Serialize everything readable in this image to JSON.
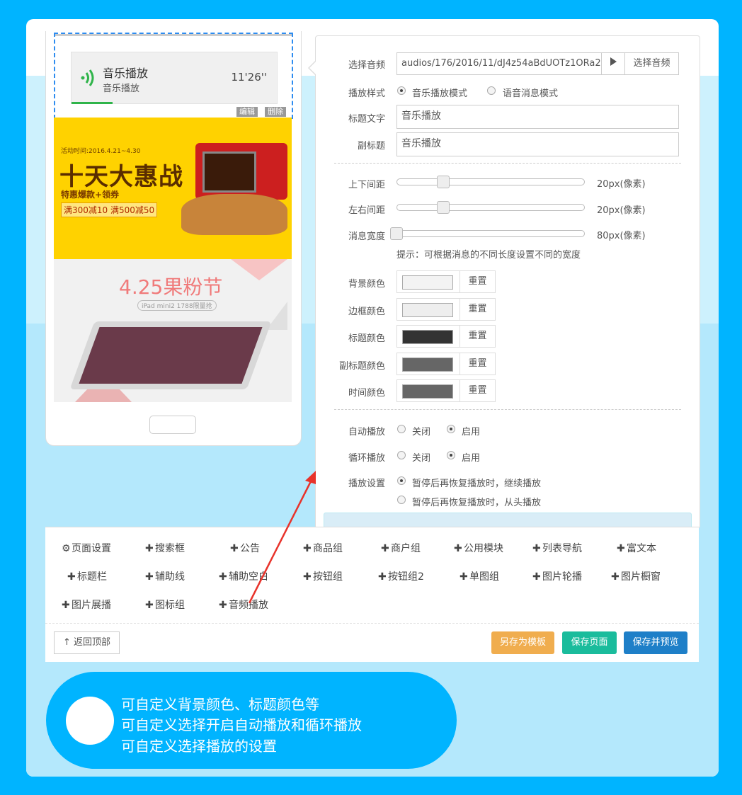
{
  "preview": {
    "audio": {
      "title": "音乐播放",
      "subtitle": "音乐播放",
      "time": "11'26''",
      "progress": 0.18
    },
    "edit_label": "编辑",
    "delete_label": "删除",
    "banner1": {
      "date": "活动时间:2016.4.21~4.30",
      "headline": "十天大惠战",
      "sub": "特惠爆款+领券",
      "coupon": "满300减10 满500减50"
    },
    "banner2": {
      "title": "4.25果粉节",
      "tag": "iPad mini2 1788限量抢"
    }
  },
  "settings": {
    "audio_label": "选择音频",
    "audio_value": "audios/176/2016/11/dJ4z54aBdUOTz1ORa2",
    "play_icon": "play-icon",
    "choose_audio": "选择音频",
    "style_label": "播放样式",
    "style_opt1": "音乐播放模式",
    "style_opt2": "语音消息模式",
    "title_label": "标题文字",
    "title_value": "音乐播放",
    "subtitle_label": "副标题",
    "subtitle_value": "音乐播放",
    "sliders": [
      {
        "label": "上下间距",
        "value": "20px(像素)",
        "level": 0.25
      },
      {
        "label": "左右间距",
        "value": "20px(像素)",
        "level": 0.25
      },
      {
        "label": "消息宽度",
        "value": "80px(像素)",
        "level": 0.0
      }
    ],
    "hint": "提示：可根据消息的不同长度设置不同的宽度",
    "colors": [
      {
        "label": "背景颜色",
        "color": "#f3f3f3"
      },
      {
        "label": "边框颜色",
        "color": "#eeeeee"
      },
      {
        "label": "标题颜色",
        "color": "#333333"
      },
      {
        "label": "副标题颜色",
        "color": "#666666"
      },
      {
        "label": "时间颜色",
        "color": "#666666"
      }
    ],
    "reset_label": "重置",
    "autoplay_label": "自动播放",
    "loop_label": "循环播放",
    "off_label": "关闭",
    "on_label": "启用",
    "playset_label": "播放设置",
    "playset_opt1": "暂停后再恢复播放时，继续播放",
    "playset_opt2": "暂停后再恢复播放时，从头播放"
  },
  "modules": {
    "row1": [
      "页面设置",
      "搜索框",
      "公告",
      "商品组",
      "商户组",
      "公用模块",
      "列表导航",
      "富文本"
    ],
    "row2": [
      "标题栏",
      "辅助线",
      "辅助空白",
      "按钮组",
      "按钮组2",
      "单图组",
      "图片轮播",
      "图片橱窗"
    ],
    "row3": [
      "图片展播",
      "图标组",
      "音频播放"
    ]
  },
  "actions": {
    "back_top": "返回顶部",
    "save_template": "另存为模板",
    "save_page": "保存页面",
    "save_preview": "保存并预览"
  },
  "callout": {
    "line1": "可自定义背景颜色、标题颜色等",
    "line2": "可自定义选择开启自动播放和循环播放",
    "line3": "可自定义选择播放的设置"
  },
  "colors": {
    "accent": "#00b4ff",
    "green": "#2fb44a",
    "orange": "#f0ad4e",
    "teal": "#1abc9c",
    "blue": "#1e7fc8"
  }
}
